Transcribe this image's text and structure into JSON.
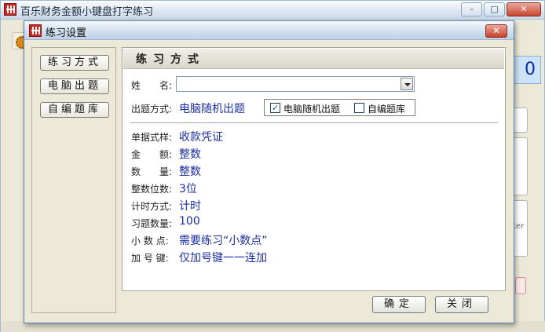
{
  "main_window": {
    "title": "百乐财务金额小键盘打字练习",
    "minimize": "–",
    "maximize": "□",
    "close": "✕",
    "counter_value": "0",
    "side_key_text": "ter"
  },
  "dialog": {
    "title": "练习设置",
    "close": "✕",
    "nav": {
      "practice_mode": "练习方式",
      "computer_questions": "电脑出题",
      "custom_bank": "自编题库"
    },
    "section_title": "练习方式",
    "name_label": "姓　　名:",
    "name_value": "",
    "mode_label": "出题方式:",
    "mode_value": "电脑随机出题",
    "mode_option_random": "电脑随机出题",
    "mode_option_random_checked": "✓",
    "mode_option_custom": "自编题库",
    "mode_option_custom_checked": "",
    "fields": [
      {
        "label": "单据式样:",
        "value": "收款凭证"
      },
      {
        "label": "金　　额:",
        "value": "整数"
      },
      {
        "label": "数　　量:",
        "value": "整数"
      },
      {
        "label": "整数位数:",
        "value": "3位"
      },
      {
        "label": "计时方式:",
        "value": "计时"
      },
      {
        "label": "习题数量:",
        "value": "100"
      },
      {
        "label": "小 数 点:",
        "value": "需要练习“小数点”"
      },
      {
        "label": "加 号 键:",
        "value": "仅加号键一一连加"
      }
    ],
    "ok": "确定",
    "close_button": "关闭"
  }
}
